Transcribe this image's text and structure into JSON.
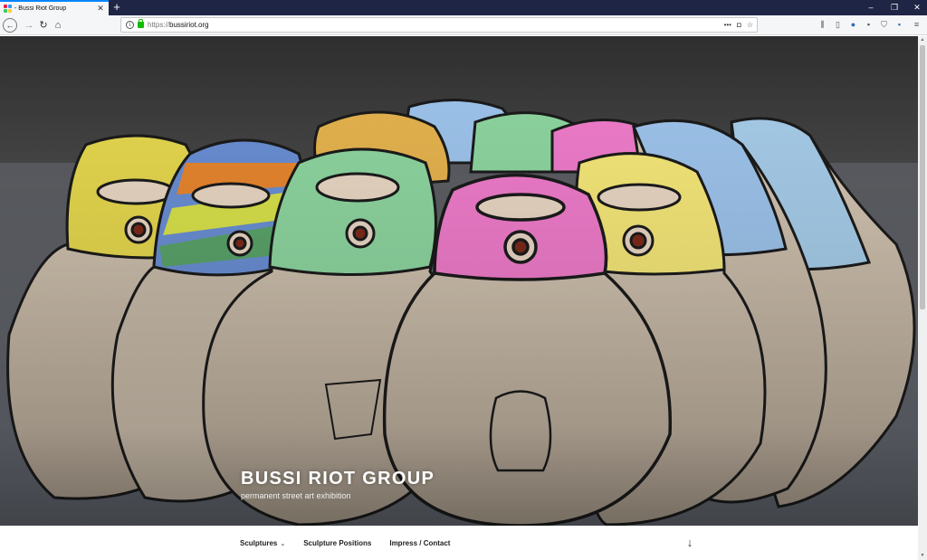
{
  "browser": {
    "tab_title": "- Bussi Riot Group",
    "new_tab": "+",
    "window_controls": {
      "minimize": "–",
      "restore": "❐",
      "close": "✕"
    },
    "url_prefix": "https://",
    "url_host": "bussiriot.org",
    "url_info": "i",
    "page_actions": {
      "more": "•••",
      "pocket": "◘",
      "bookmark": "☆"
    },
    "menu": "≡"
  },
  "hero": {
    "site_title": "Bussi Riot Group",
    "site_description": "permanent street art exhibition",
    "balaclava_colors": [
      "#e6d84e",
      "#f07ccb",
      "#8ed6a0",
      "#9ec4ec",
      "#f6e879",
      "#a7cdea",
      "#d9e24a"
    ]
  },
  "nav": {
    "items": [
      {
        "label": "Sculptures",
        "has_submenu": true
      },
      {
        "label": "Sculpture Positions",
        "has_submenu": false
      },
      {
        "label": "Impress / Contact",
        "has_submenu": false
      }
    ],
    "submenu_caret": "⌄",
    "scroll_down": "↓"
  },
  "colors": {
    "title_bar": "#1f2544",
    "tab_accent": "#0a84ff",
    "secure_lock": "#12bc00"
  }
}
